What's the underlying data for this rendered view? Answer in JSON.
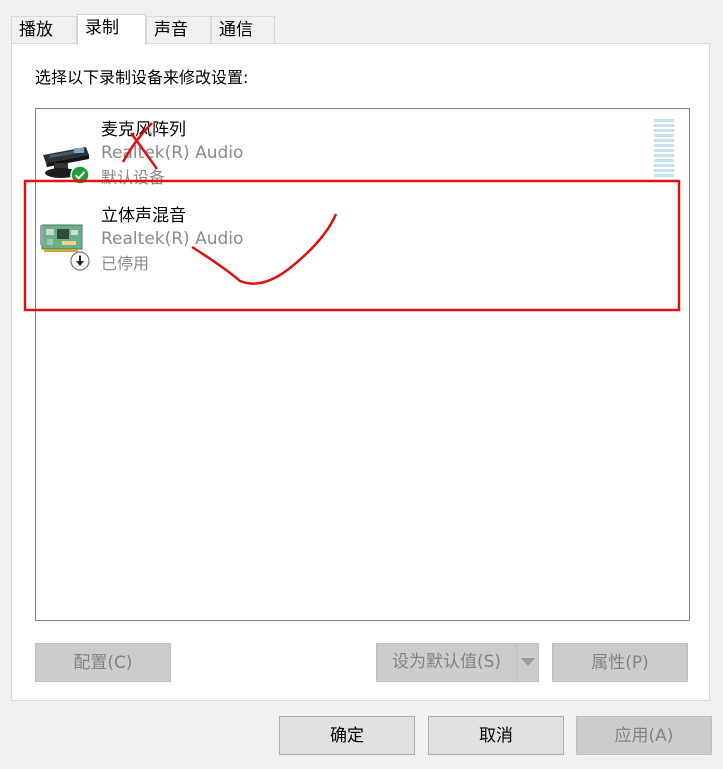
{
  "tabs": [
    {
      "label": "播放",
      "active": false
    },
    {
      "label": "录制",
      "active": true
    },
    {
      "label": "声音",
      "active": false
    },
    {
      "label": "通信",
      "active": false
    }
  ],
  "prompt": "选择以下录制设备来修改设置:",
  "devices": [
    {
      "name": "麦克风阵列",
      "driver": "Realtek(R) Audio",
      "status": "默认设备",
      "icon": "microphone-array-icon",
      "badge": "default-checkmark-icon",
      "badge_color": "#1e9e3a"
    },
    {
      "name": "立体声混音",
      "driver": "Realtek(R) Audio",
      "status": "已停用",
      "icon": "sound-card-icon",
      "badge": "disabled-down-arrow-icon"
    }
  ],
  "buttons": {
    "configure": "配置(C)",
    "set_default": "设为默认值(S)",
    "properties": "属性(P)",
    "ok": "确定",
    "cancel": "取消",
    "apply": "应用(A)"
  },
  "colors": {
    "annotation": "#e01010",
    "disabled_text": "#838383",
    "meter": "#c5dfee"
  }
}
